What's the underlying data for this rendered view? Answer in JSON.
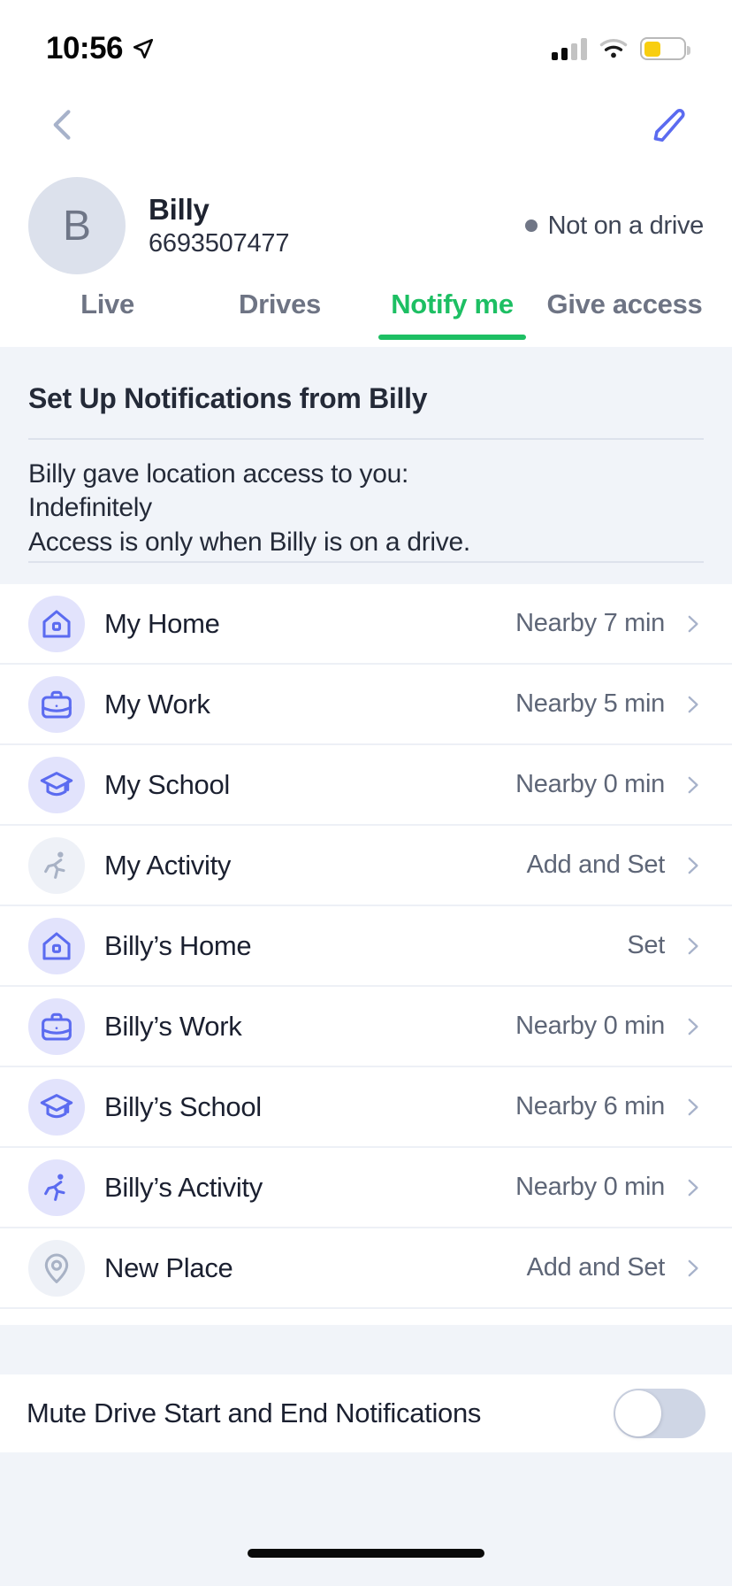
{
  "status_bar": {
    "time": "10:56",
    "location_arrow": "location-arrow-icon",
    "signal": "cellular-signal-icon",
    "wifi": "wifi-icon",
    "battery": "battery-low-power-icon",
    "battery_color": "#F8CE10"
  },
  "navbar": {
    "back": "back-chevron-icon",
    "edit": "edit-pencil-icon",
    "back_color": "#A7B2CA",
    "edit_color": "#5B6BF0"
  },
  "profile": {
    "avatar_initial": "B",
    "name": "Billy",
    "phone": "6693507477",
    "status": "Not on a drive",
    "status_dot_color": "#707686"
  },
  "tabs": {
    "accent": "#1DBF63",
    "items": [
      {
        "label": "Live",
        "active": false
      },
      {
        "label": "Drives",
        "active": false
      },
      {
        "label": "Notify me",
        "active": true
      },
      {
        "label": "Give access",
        "active": false
      }
    ]
  },
  "info_panel": {
    "title": "Set Up Notifications from Billy",
    "line1": "Billy gave location access to you:",
    "line2": "Indefinitely",
    "line3": "Access is only when Billy is on a drive."
  },
  "places": [
    {
      "label": "My Home",
      "value": "Nearby 7 min",
      "icon": "home-icon",
      "icon_state": "active"
    },
    {
      "label": "My Work",
      "value": "Nearby 5 min",
      "icon": "briefcase-icon",
      "icon_state": "active"
    },
    {
      "label": "My School",
      "value": "Nearby 0 min",
      "icon": "graduation-cap-icon",
      "icon_state": "active"
    },
    {
      "label": "My Activity",
      "value": "Add and Set",
      "icon": "running-person-icon",
      "icon_state": "muted"
    },
    {
      "label": "Billy’s Home",
      "value": "Set",
      "icon": "home-icon",
      "icon_state": "active"
    },
    {
      "label": "Billy’s Work",
      "value": "Nearby 0 min",
      "icon": "briefcase-icon",
      "icon_state": "active"
    },
    {
      "label": "Billy’s School",
      "value": "Nearby 6 min",
      "icon": "graduation-cap-icon",
      "icon_state": "active"
    },
    {
      "label": "Billy’s Activity",
      "value": "Nearby 0 min",
      "icon": "running-person-icon",
      "icon_state": "active"
    },
    {
      "label": "New Place",
      "value": "Add and Set",
      "icon": "map-pin-icon",
      "icon_state": "muted"
    }
  ],
  "mute_setting": {
    "label": "Mute Drive Start and End Notifications",
    "enabled": false
  },
  "colors": {
    "icon_active": "#5B6BF0",
    "icon_muted": "#A8B2C5",
    "icon_bg_active": "#E2E3FC",
    "icon_bg_muted": "#EEF1F7",
    "panel_bg": "#F1F4F9",
    "chevron": "#A7B2CA"
  }
}
